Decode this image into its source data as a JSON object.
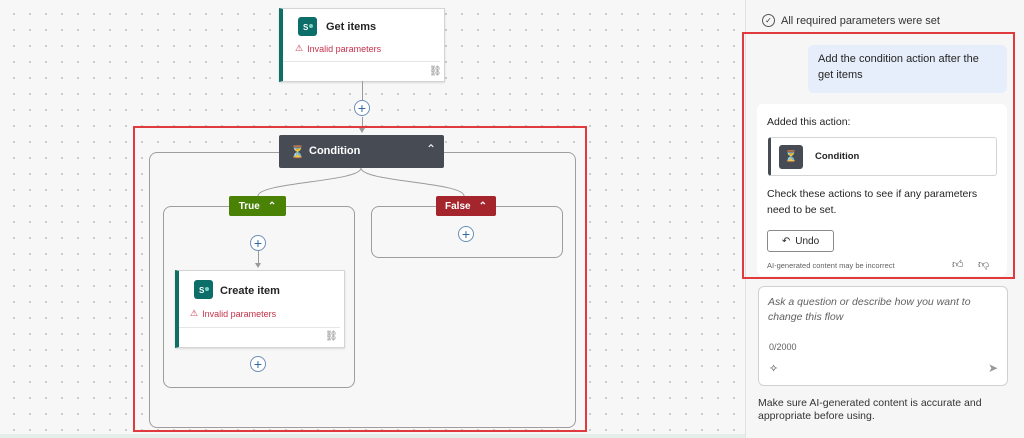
{
  "flow": {
    "get_items": {
      "title": "Get items",
      "status": "Invalid parameters"
    },
    "condition": {
      "title": "Condition"
    },
    "true_branch": {
      "label": "True"
    },
    "false_branch": {
      "label": "False"
    },
    "create_item": {
      "title": "Create item",
      "status": "Invalid parameters"
    }
  },
  "copilot": {
    "status_text": "All required parameters were set",
    "user_message": "Add the condition action after the get items",
    "response": {
      "intro": "Added this action:",
      "action_name": "Condition",
      "check_text": "Check these actions to see if any parameters need to be set.",
      "undo_label": "Undo",
      "disclaimer": "AI-generated content may be incorrect"
    },
    "input": {
      "placeholder": "Ask a question or describe how you want to change this flow",
      "counter": "0/2000"
    },
    "footer_note": "Make sure AI-generated content is accurate and appropriate before using."
  },
  "colors": {
    "true_branch": "#498205",
    "false_branch": "#a4262c",
    "condition_header": "#474c54",
    "connector": "#0c6e69",
    "highlight": "#e0393e"
  }
}
